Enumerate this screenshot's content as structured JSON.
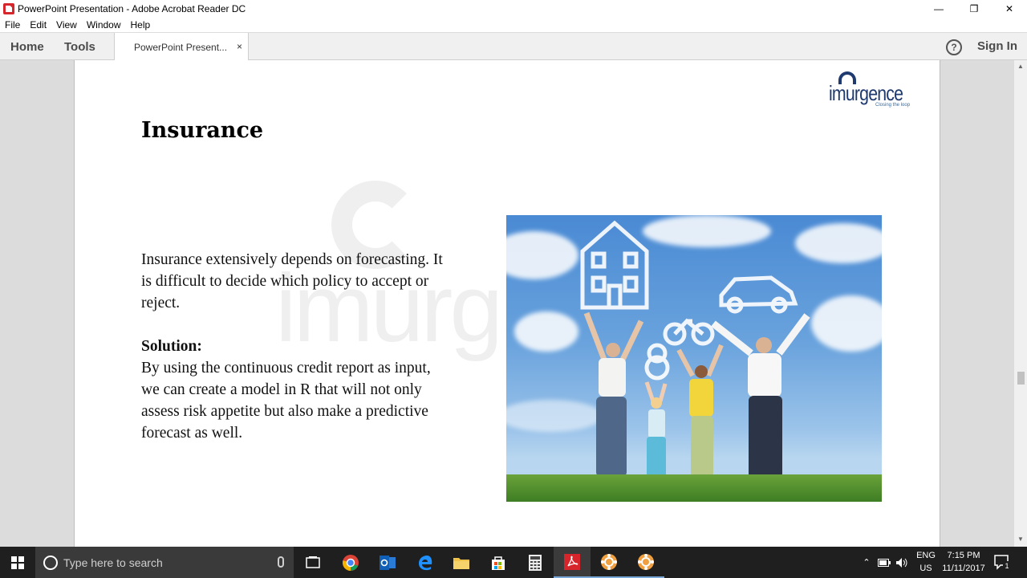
{
  "window": {
    "title": "PowerPoint Presentation - Adobe Acrobat Reader DC",
    "controls": {
      "minimize": "—",
      "restore": "❐",
      "close": "✕"
    }
  },
  "menu": [
    "File",
    "Edit",
    "View",
    "Window",
    "Help"
  ],
  "tabs": {
    "home": "Home",
    "tools": "Tools",
    "document": "PowerPoint Present...",
    "close": "×",
    "help": "?",
    "sign_in": "Sign In"
  },
  "slide": {
    "title": "Insurance",
    "paragraph": "Insurance extensively depends on forecasting. It is difficult to decide which policy to accept or reject.",
    "solution_heading": "Solution:",
    "solution_text": "By  using the continuous credit report as input, we can create a model in R that will not only assess risk appetite but also make a predictive forecast as well.",
    "logo": {
      "name": "imurgence",
      "tagline": "Closing the loop"
    }
  },
  "taskbar": {
    "search_placeholder": "Type here to search",
    "language": "ENG",
    "region": "US",
    "time": "7:15 PM",
    "date": "11/11/2017",
    "notification_count": "1",
    "apps": [
      "task-view-icon",
      "chrome-icon",
      "outlook-icon",
      "edge-icon",
      "file-explorer-icon",
      "store-icon",
      "calculator-icon",
      "acrobat-icon",
      "app-icon",
      "app-icon"
    ]
  },
  "colors": {
    "acrobat_red": "#d7262b",
    "logo_blue": "#1e3a6e",
    "taskbar": "#1f1f1f"
  }
}
